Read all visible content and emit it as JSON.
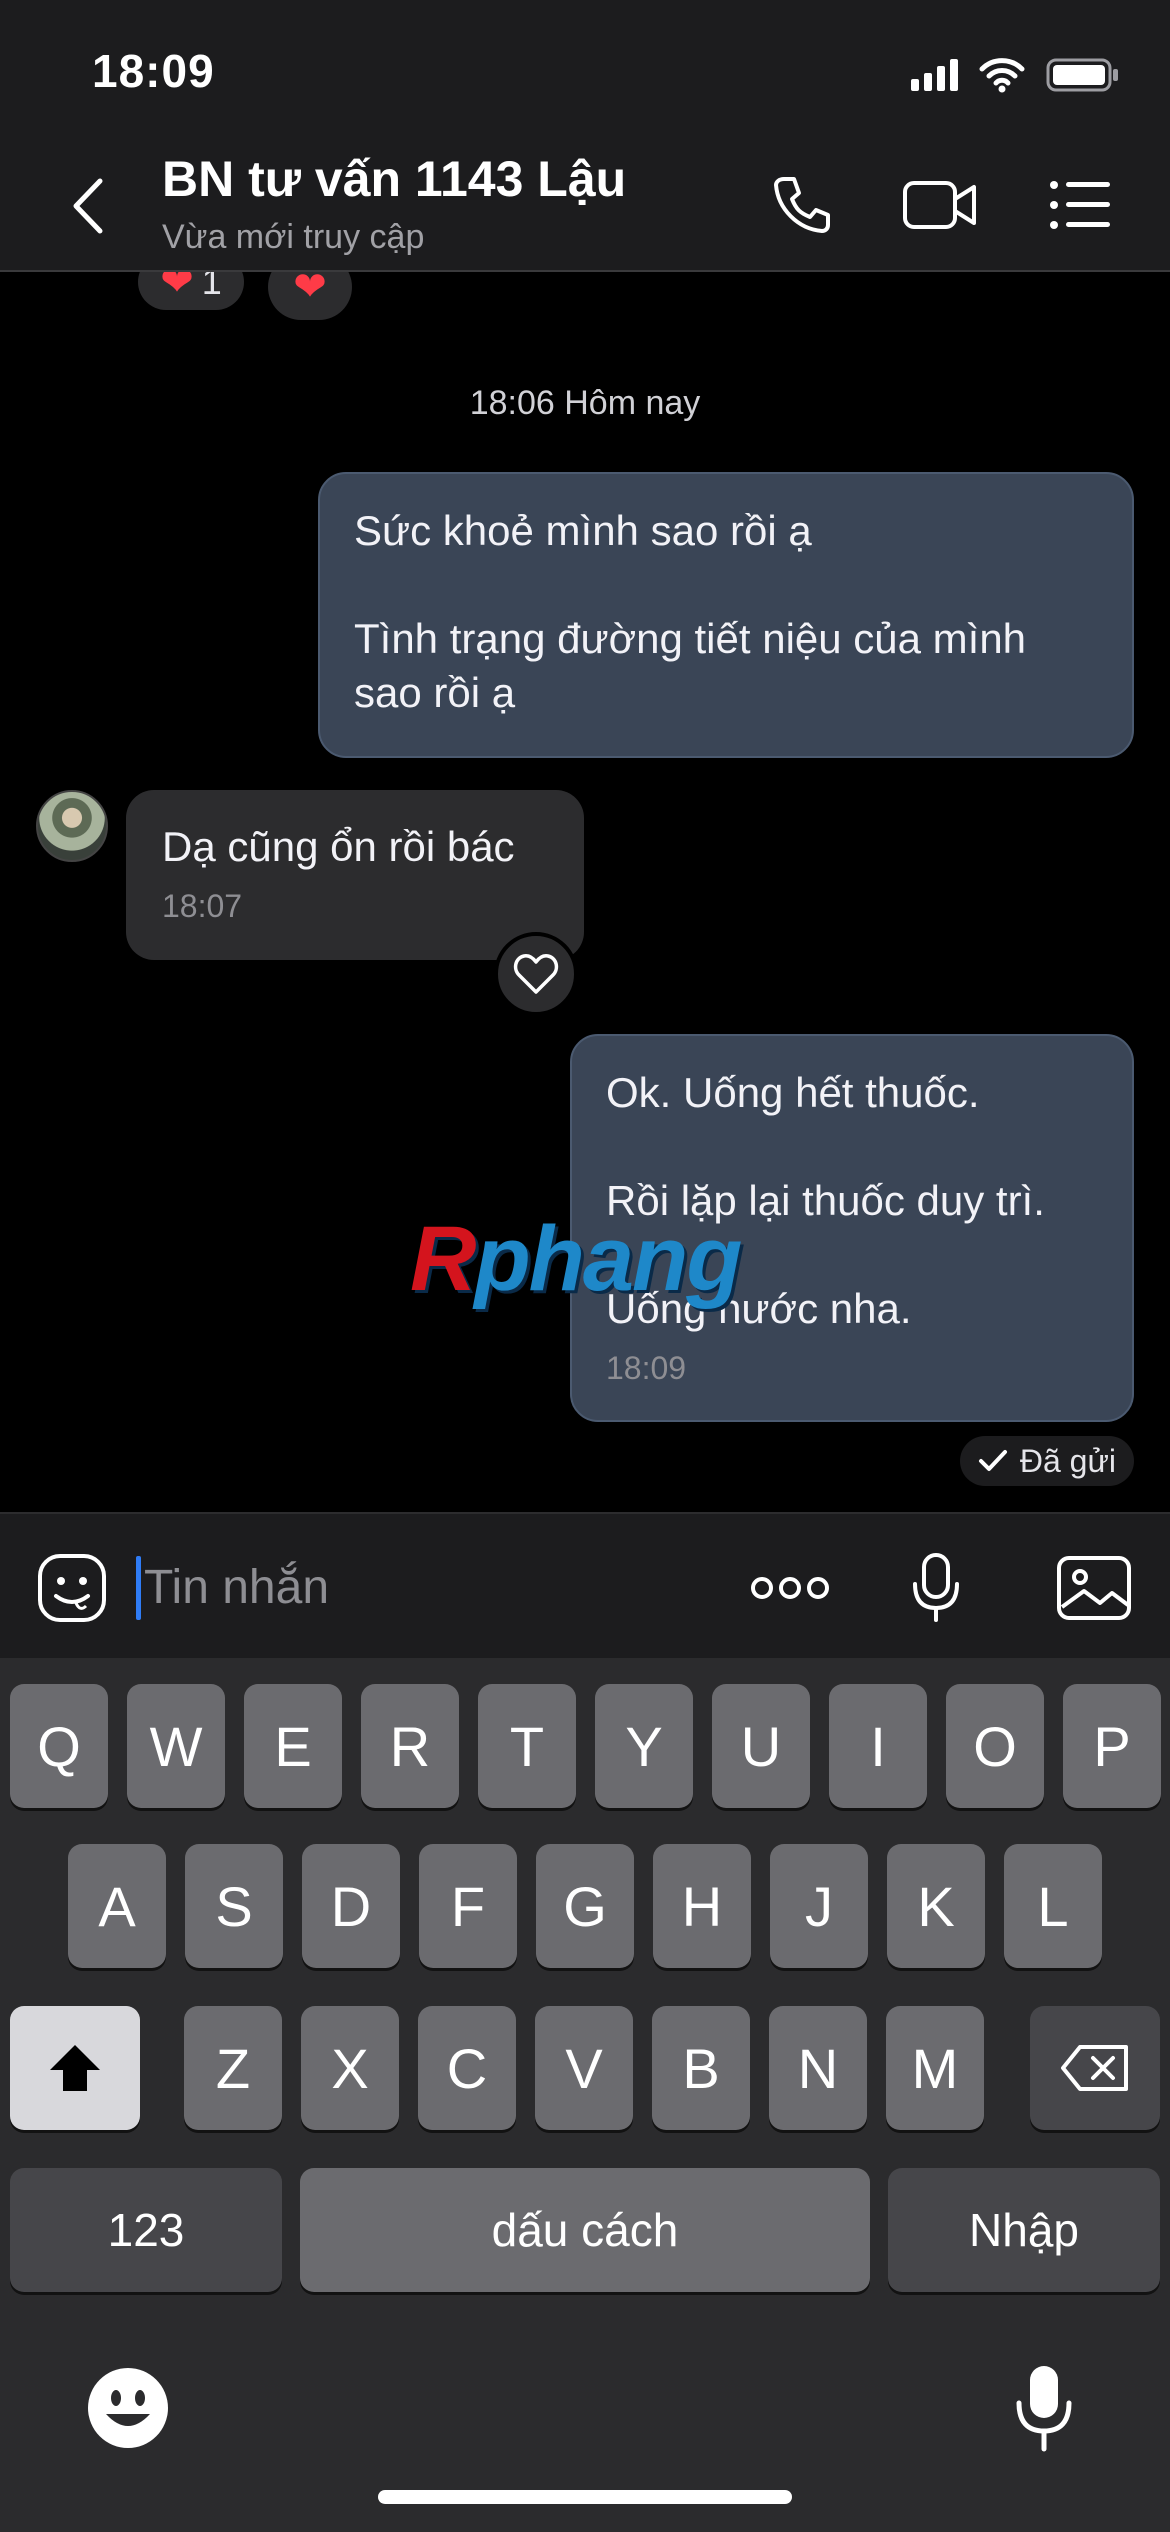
{
  "status_bar": {
    "time": "18:09"
  },
  "header": {
    "title": "BN tư vấn 1143 Lậu",
    "subtitle": "Vừa mới truy cập",
    "icons": [
      "back-chevron-icon",
      "phone-icon",
      "video-camera-icon",
      "menu-list-icon"
    ]
  },
  "chat": {
    "top_reaction_count": "1",
    "date_separator": "18:06 Hôm nay",
    "messages": [
      {
        "direction": "outgoing",
        "lines": [
          "Sức khoẻ mình sao rồi ạ",
          "",
          "Tình trạng đường tiết niệu của mình",
          "sao rồi ạ"
        ]
      },
      {
        "direction": "incoming",
        "lines": [
          "Dạ cũng ổn rồi bác"
        ],
        "time": "18:07"
      },
      {
        "direction": "outgoing",
        "lines": [
          "Ok. Uống hết thuốc.",
          "",
          "Rồi lặp lại thuốc duy trì.",
          "",
          "Uống nước nha."
        ],
        "time": "18:09"
      }
    ],
    "watermark": {
      "r": "R",
      "rest": "phang"
    },
    "sent_status": "Đã gửi"
  },
  "composer": {
    "placeholder": "Tin nhắn",
    "icons": [
      "sticker-face-icon",
      "more-options-icon",
      "microphone-icon",
      "image-gallery-icon"
    ]
  },
  "keyboard": {
    "row1": [
      "Q",
      "W",
      "E",
      "R",
      "T",
      "Y",
      "U",
      "I",
      "O",
      "P"
    ],
    "row2": [
      "A",
      "S",
      "D",
      "F",
      "G",
      "H",
      "J",
      "K",
      "L"
    ],
    "row3": [
      "Z",
      "X",
      "C",
      "V",
      "B",
      "N",
      "M"
    ],
    "numbers_label": "123",
    "space_label": "dấu cách",
    "return_label": "Nhập"
  },
  "colors": {
    "outgoing_bubble": "#3a4556",
    "incoming_bubble": "#2c2c2e",
    "caret": "#2f7cf6",
    "heart": "#ff3b47"
  }
}
